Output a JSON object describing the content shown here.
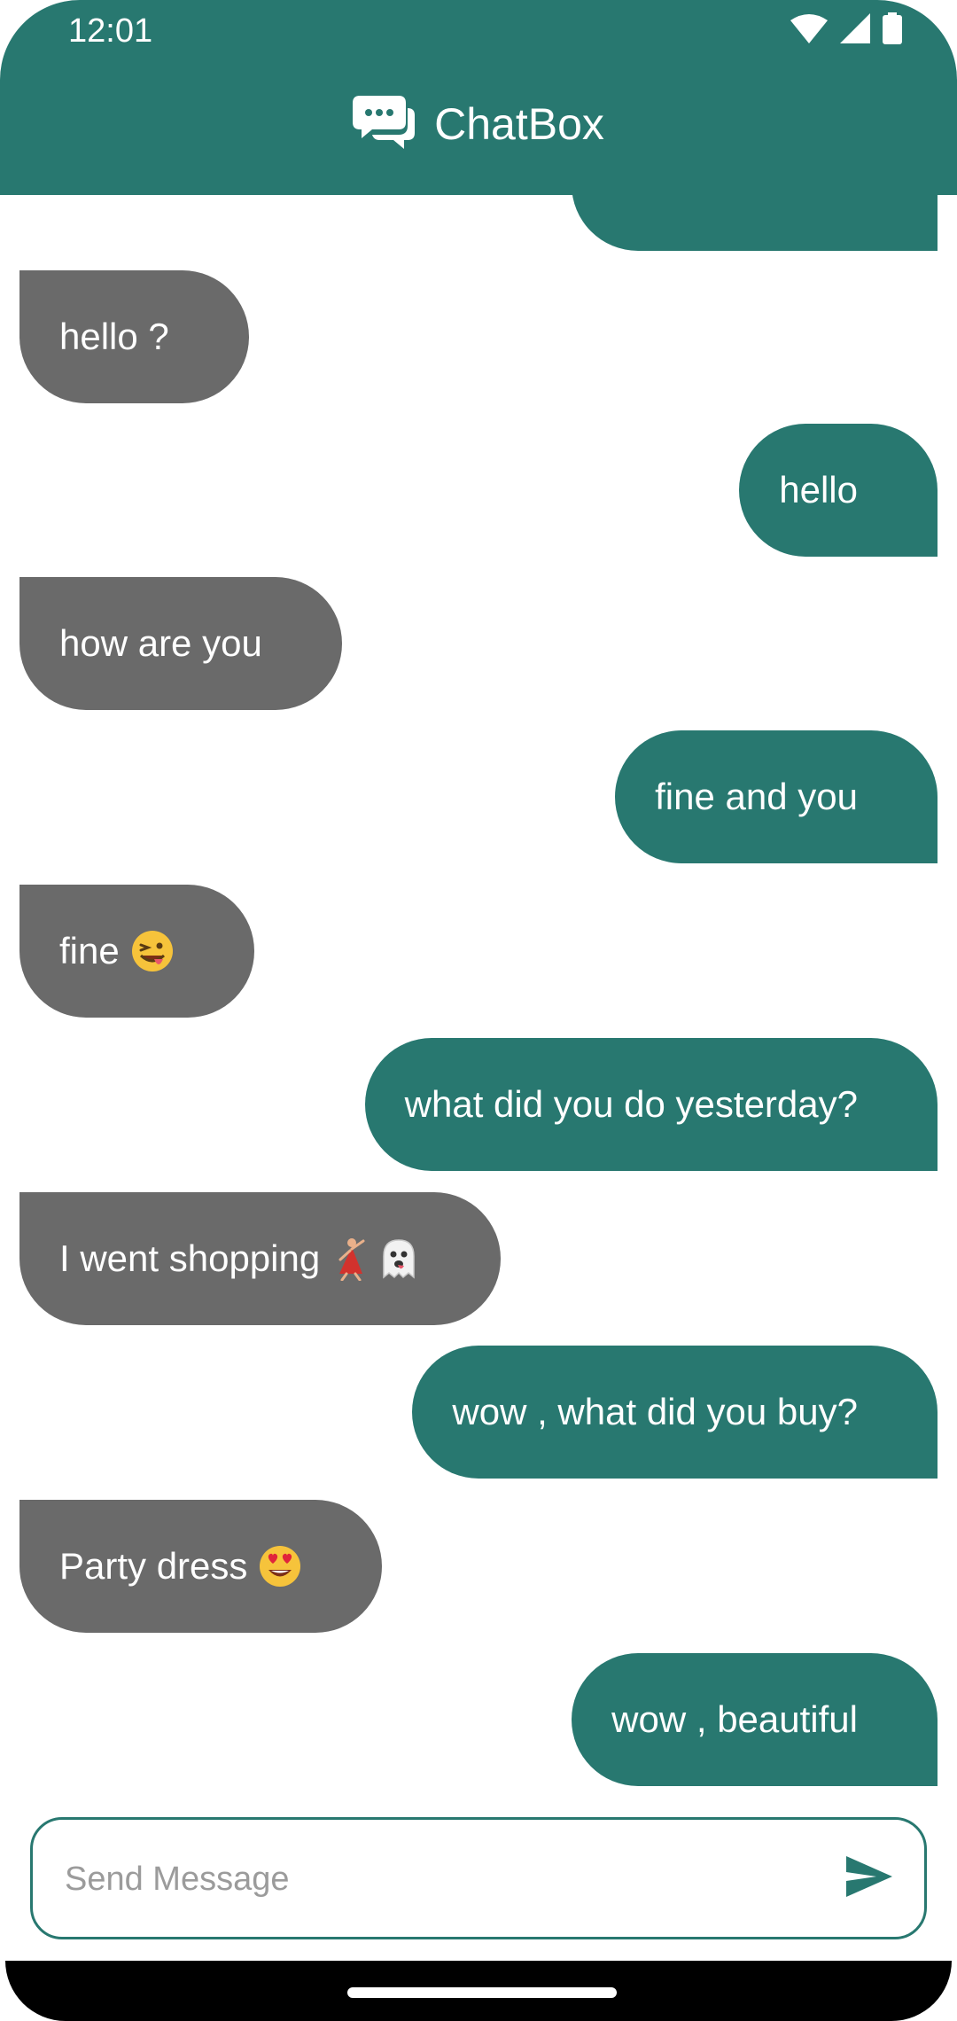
{
  "status_bar": {
    "time": "12:01"
  },
  "header": {
    "title": "ChatBox",
    "logo_icon": "chat-bubble-icon"
  },
  "colors": {
    "primary": "#287870",
    "incoming": "#6a6a6a",
    "background": "#ffffff"
  },
  "messages": [
    {
      "direction": "out",
      "text": "...",
      "partial": true
    },
    {
      "direction": "in",
      "text": "hello ?"
    },
    {
      "direction": "out",
      "text": "hello"
    },
    {
      "direction": "in",
      "text": "how are you"
    },
    {
      "direction": "out",
      "text": "fine and you"
    },
    {
      "direction": "in",
      "text": "fine",
      "emoji": [
        "winking-face-with-tongue"
      ]
    },
    {
      "direction": "out",
      "text": "what did you do yesterday?"
    },
    {
      "direction": "in",
      "text": "I went shopping",
      "emoji": [
        "woman-dancing",
        "ghost"
      ]
    },
    {
      "direction": "out",
      "text": "wow , what did you buy?"
    },
    {
      "direction": "in",
      "text": "Party dress",
      "emoji": [
        "smiling-face-with-heart-eyes"
      ]
    },
    {
      "direction": "out",
      "text": "wow , beautiful"
    }
  ],
  "composer": {
    "placeholder": "Send Message",
    "value": "",
    "send_icon": "send-icon"
  }
}
